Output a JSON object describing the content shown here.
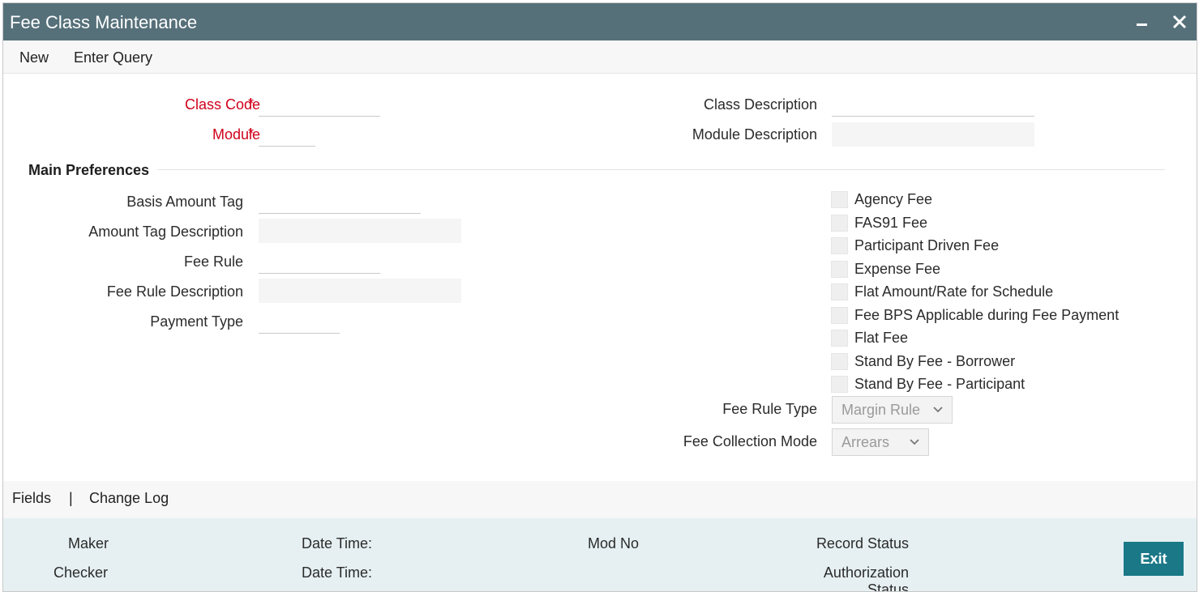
{
  "window": {
    "title": "Fee Class Maintenance",
    "minimize_icon": "minimize-icon",
    "close_icon": "close-icon"
  },
  "toolbar": {
    "new_label": "New",
    "enter_query_label": "Enter Query"
  },
  "header": {
    "class_code_label": "Class Code",
    "module_label": "Module",
    "required_marker": "*",
    "class_description_label": "Class Description",
    "module_description_label": "Module Description",
    "class_code_value": "",
    "module_value": "",
    "class_description_value": "",
    "module_description_value": ""
  },
  "main_preferences": {
    "title": "Main Preferences",
    "basis_amount_tag_label": "Basis Amount Tag",
    "amount_tag_description_label": "Amount Tag Description",
    "fee_rule_label": "Fee Rule",
    "fee_rule_description_label": "Fee Rule Description",
    "payment_type_label": "Payment Type",
    "checkboxes": [
      {
        "label": "Agency Fee",
        "checked": false
      },
      {
        "label": "FAS91 Fee",
        "checked": false
      },
      {
        "label": "Participant Driven Fee",
        "checked": false
      },
      {
        "label": "Expense Fee",
        "checked": false
      },
      {
        "label": "Flat Amount/Rate for Schedule",
        "checked": false
      },
      {
        "label": "Fee BPS Applicable during Fee Payment",
        "checked": false
      },
      {
        "label": "Flat Fee",
        "checked": false
      },
      {
        "label": "Stand By Fee - Borrower",
        "checked": false
      },
      {
        "label": "Stand By Fee - Participant",
        "checked": false
      }
    ],
    "fee_rule_type_label": "Fee Rule Type",
    "fee_rule_type_value": "Margin Rule",
    "fee_collection_mode_label": "Fee Collection Mode",
    "fee_collection_mode_value": "Arrears"
  },
  "footer_links": {
    "fields_label": "Fields",
    "separator": "|",
    "change_log_label": "Change Log"
  },
  "audit": {
    "maker_label": "Maker",
    "checker_label": "Checker",
    "date_time_label_1": "Date Time:",
    "date_time_label_2": "Date Time:",
    "mod_no_label": "Mod No",
    "record_status_label": "Record Status",
    "authorization_status_label_line1": "Authorization",
    "authorization_status_label_line2": "Status",
    "exit_label": "Exit"
  },
  "colors": {
    "titlebar": "#56707a",
    "required": "#d0021b",
    "exit_button": "#1a7887",
    "audit_bg": "#e6f0f2"
  }
}
